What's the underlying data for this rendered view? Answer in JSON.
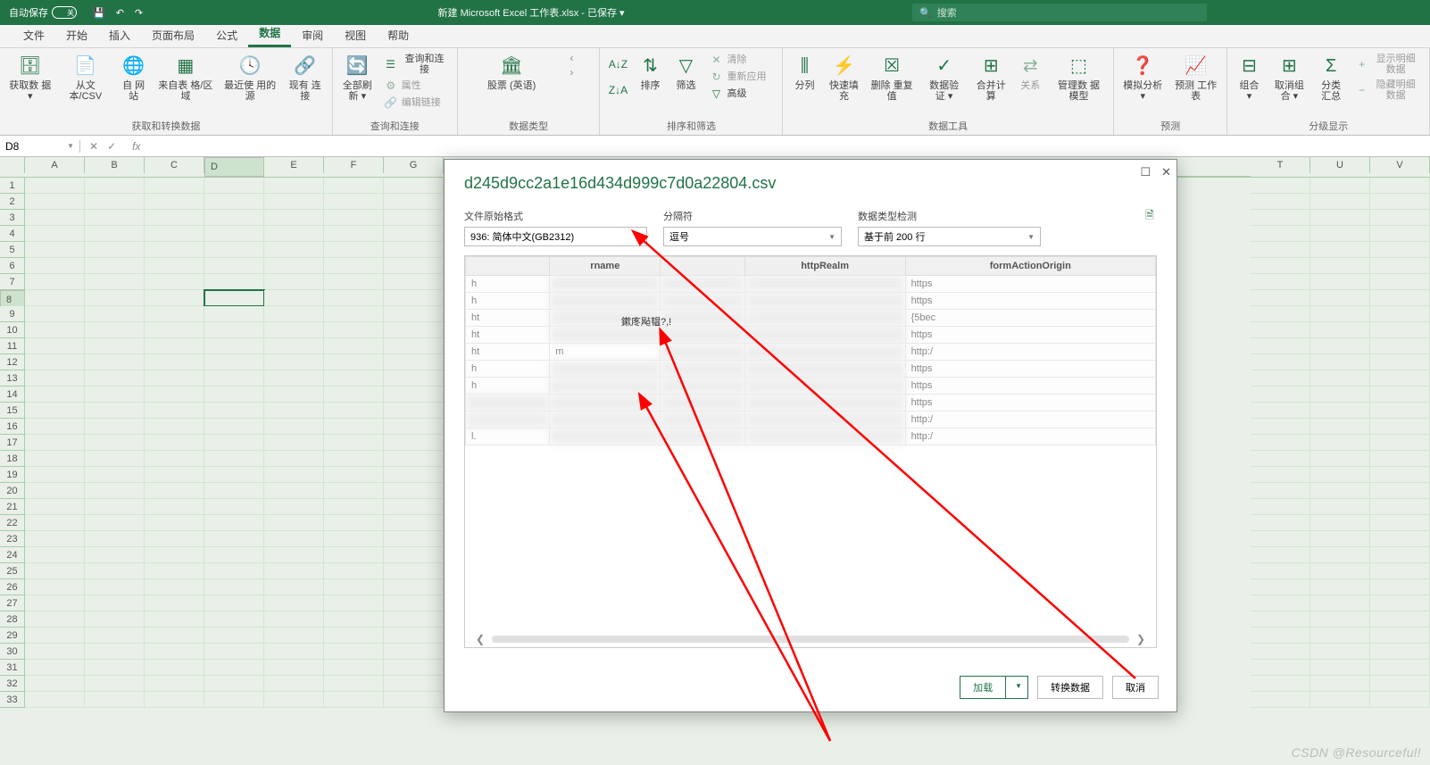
{
  "titlebar": {
    "autosave": "自动保存",
    "toggle": "关",
    "doc_title": "新建 Microsoft Excel 工作表.xlsx - 已保存 ▾",
    "search_placeholder": "搜索"
  },
  "tabs": [
    "文件",
    "开始",
    "插入",
    "页面布局",
    "公式",
    "数据",
    "审阅",
    "视图",
    "帮助"
  ],
  "active_tab": "数据",
  "ribbon": {
    "g1": {
      "label": "获取和转换数据",
      "btns": [
        "获取数\n据 ▾",
        "从文\n本/CSV",
        "自\n网站",
        "来自表\n格/区域",
        "最近使\n用的源",
        "现有\n连接"
      ]
    },
    "g2": {
      "label": "查询和连接",
      "main": "全部刷新\n▾",
      "sub": [
        "查询和连接",
        "属性",
        "编辑链接"
      ]
    },
    "g3": {
      "label": "数据类型",
      "btns": [
        "股票 (英语)"
      ]
    },
    "g4": {
      "label": "排序和筛选",
      "btns": [
        "A↓Z",
        "Z↓A",
        "排序",
        "筛选"
      ],
      "sub": [
        "清除",
        "重新应用",
        "高级"
      ]
    },
    "g5": {
      "label": "数据工具",
      "btns": [
        "分列",
        "快速填充",
        "删除\n重复值",
        "数据验\n证 ▾",
        "合并计算",
        "关系",
        "管理数\n据模型"
      ]
    },
    "g6": {
      "label": "预测",
      "btns": [
        "模拟分析\n▾",
        "预测\n工作表"
      ]
    },
    "g7": {
      "label": "分级显示",
      "btns": [
        "组合\n▾",
        "取消组合\n▾",
        "分类汇总"
      ],
      "sub": [
        "显示明细数据",
        "隐藏明细数据"
      ]
    }
  },
  "formula": {
    "namebox": "D8",
    "fx": "fx"
  },
  "columns": [
    "A",
    "B",
    "C",
    "D",
    "E",
    "F",
    "G"
  ],
  "columns_right": [
    "T",
    "U",
    "V"
  ],
  "active_cell": {
    "col": "D",
    "row": 8
  },
  "dialog": {
    "title": "d245d9cc2a1e16d434d999c7d0a22804.csv",
    "field1_label": "文件原始格式",
    "field1_value": "936: 简体中文(GB2312)",
    "field2_label": "分隔符",
    "field2_value": "逗号",
    "field3_label": "数据类型检测",
    "field3_value": "基于前 200 行",
    "headers": [
      "",
      "rname",
      "",
      "httpRealm",
      "formActionOrigin"
    ],
    "garbled": "鏉庝飐韫?,!",
    "rows": [
      [
        "h",
        "",
        "",
        "",
        "https"
      ],
      [
        "h",
        "",
        "",
        "",
        "https"
      ],
      [
        "ht",
        "",
        "",
        "",
        "{5bec"
      ],
      [
        "ht",
        "",
        "",
        "",
        "https"
      ],
      [
        "ht",
        "m",
        "",
        "",
        "http:/"
      ],
      [
        "h",
        "",
        "",
        "",
        "https"
      ],
      [
        "h",
        "",
        "",
        "",
        "https"
      ],
      [
        "",
        "",
        "",
        "",
        "https"
      ],
      [
        "",
        "",
        "",
        "",
        "http:/"
      ],
      [
        "l.",
        "",
        "",
        "",
        "http:/"
      ]
    ],
    "btn_load": "加载",
    "btn_transform": "转换数据",
    "btn_cancel": "取消"
  },
  "watermark": "CSDN @Resourceful!"
}
